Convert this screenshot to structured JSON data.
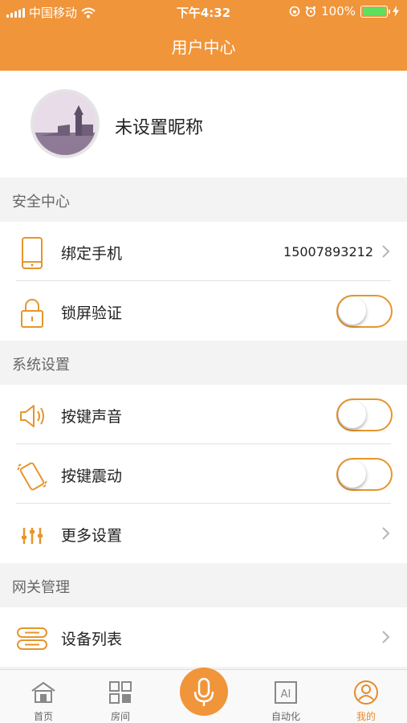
{
  "status_bar": {
    "carrier": "中国移动",
    "time": "下午4:32",
    "battery": "100%"
  },
  "header": {
    "title": "用户中心"
  },
  "profile": {
    "nickname": "未设置昵称"
  },
  "sections": [
    {
      "title": "安全中心"
    },
    {
      "title": "系统设置"
    },
    {
      "title": "网关管理"
    }
  ],
  "rows": {
    "bind_phone": {
      "label": "绑定手机",
      "value": "15007893212"
    },
    "lock_screen": {
      "label": "锁屏验证",
      "enabled": false
    },
    "key_sound": {
      "label": "按键声音",
      "enabled": false
    },
    "key_vibrate": {
      "label": "按键震动",
      "enabled": false
    },
    "more_settings": {
      "label": "更多设置"
    },
    "device_list": {
      "label": "设备列表"
    }
  },
  "tabbar": {
    "items": [
      {
        "label": "首页",
        "icon": "home-icon"
      },
      {
        "label": "房间",
        "icon": "grid-icon"
      },
      {
        "label": "",
        "icon": "microphone-icon"
      },
      {
        "label": "自动化",
        "icon": "ai-icon"
      },
      {
        "label": "我的",
        "icon": "user-icon",
        "active": true
      }
    ]
  },
  "colors": {
    "accent": "#f0953a",
    "toggle_border": "#e6952c",
    "active_tab": "#e88a2a"
  }
}
